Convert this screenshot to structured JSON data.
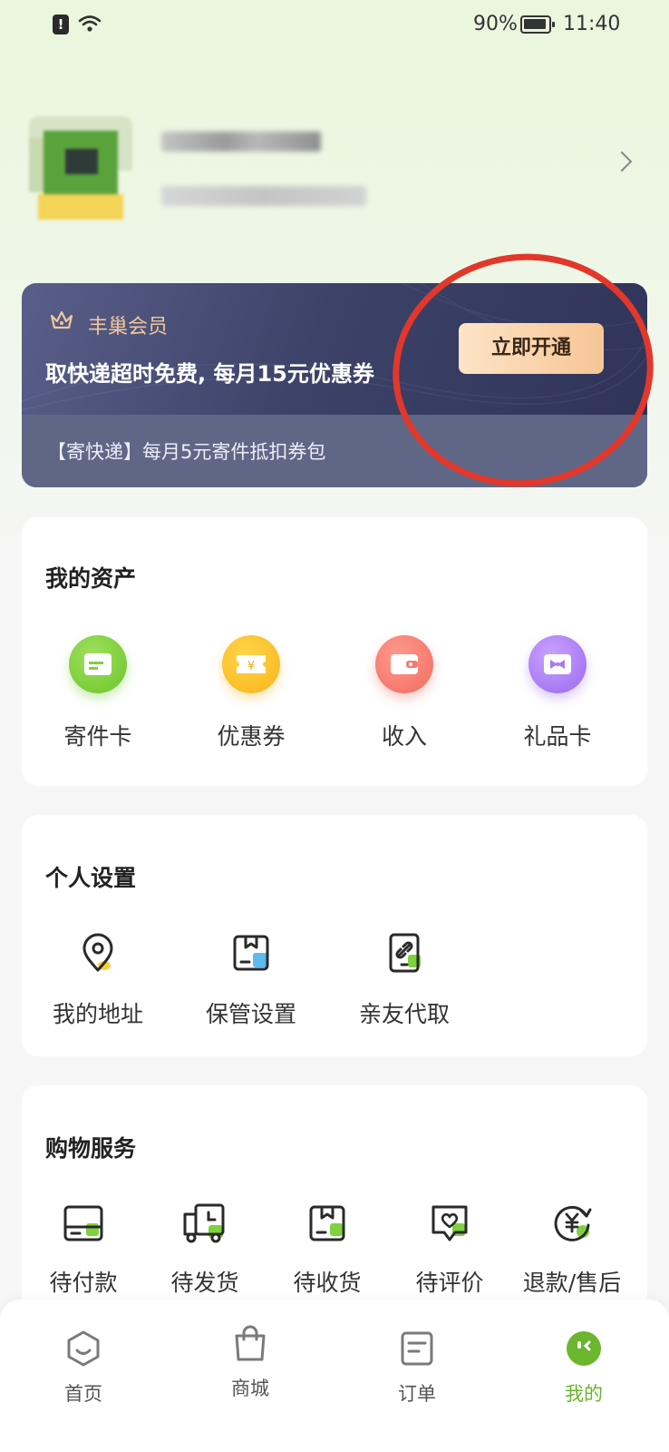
{
  "status_bar": {
    "battery": "90%",
    "time": "11:40"
  },
  "member": {
    "title": "丰巢会员",
    "description": "取快递超时免费, 每月15元优惠券",
    "button": "立即开通",
    "subtitle": "【寄快递】每月5元寄件抵扣券包"
  },
  "assets": {
    "title": "我的资产",
    "items": [
      {
        "label": "寄件卡",
        "icon": "card-icon",
        "color": "#7ed23e"
      },
      {
        "label": "优惠券",
        "icon": "coupon-icon",
        "color": "#fbbd1e"
      },
      {
        "label": "收入",
        "icon": "wallet-icon",
        "color": "#f37b72"
      },
      {
        "label": "礼品卡",
        "icon": "gift-card-icon",
        "color": "#a97af1"
      }
    ]
  },
  "settings": {
    "title": "个人设置",
    "items": [
      {
        "label": "我的地址",
        "icon": "location-pin-icon"
      },
      {
        "label": "保管设置",
        "icon": "storage-box-icon"
      },
      {
        "label": "亲友代取",
        "icon": "link-phone-icon"
      }
    ]
  },
  "shopping": {
    "title": "购物服务",
    "items": [
      {
        "label": "待付款",
        "icon": "payment-card-icon"
      },
      {
        "label": "待发货",
        "icon": "delivery-truck-icon"
      },
      {
        "label": "待收货",
        "icon": "package-box-icon"
      },
      {
        "label": "待评价",
        "icon": "review-heart-icon"
      },
      {
        "label": "退款/售后",
        "icon": "refund-yen-icon"
      }
    ]
  },
  "bottom_nav": {
    "items": [
      {
        "label": "首页",
        "icon": "home-hexagon-icon"
      },
      {
        "label": "商城",
        "icon": "shopping-bag-icon"
      },
      {
        "label": "订单",
        "icon": "order-list-icon"
      },
      {
        "label": "我的",
        "icon": "profile-face-icon",
        "active": true
      }
    ]
  },
  "colors": {
    "accent_green": "#6bb52f",
    "member_bg": "#3d4269",
    "annotation_red": "#e1382b"
  }
}
